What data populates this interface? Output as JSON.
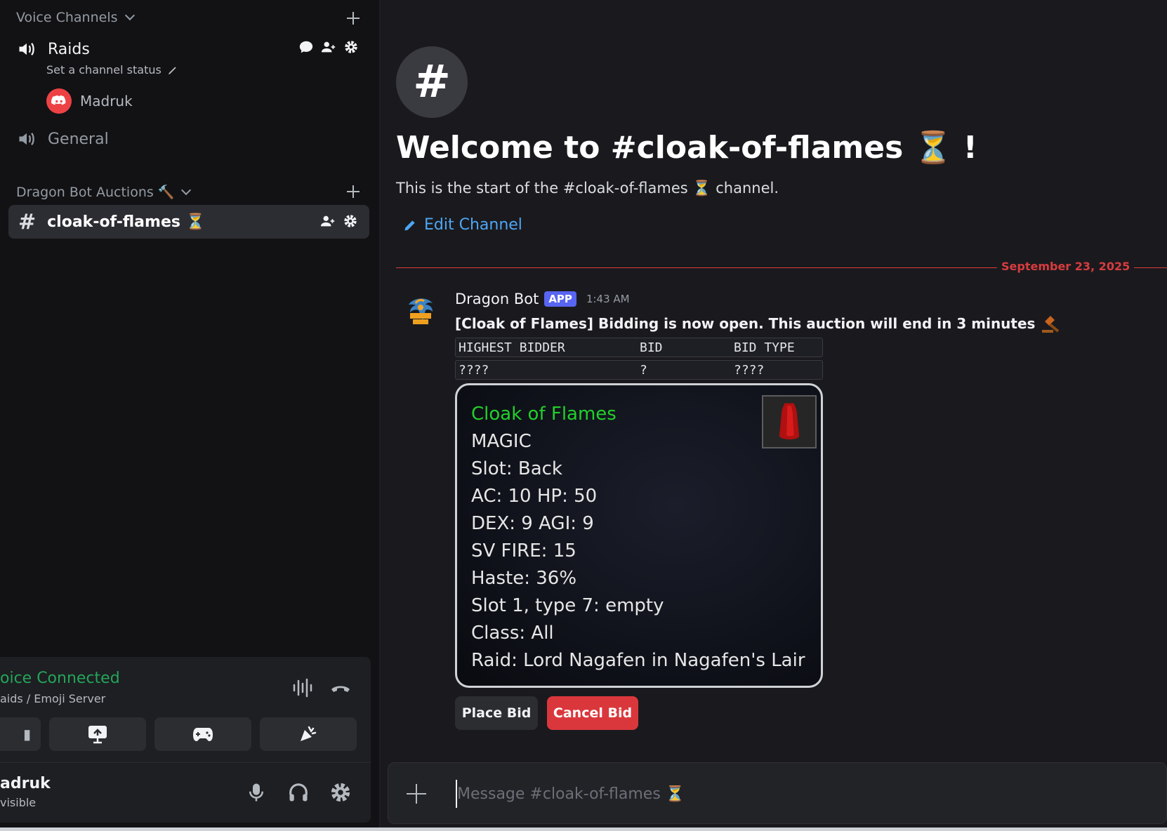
{
  "sidebar": {
    "voice_category": "Voice Channels",
    "voice_channels": [
      {
        "name": "Raids",
        "status": "Set a channel status",
        "members": [
          "Madruk"
        ]
      },
      {
        "name": "General"
      }
    ],
    "auction_category": "Dragon Bot Auctions 🔨",
    "active_channel": "cloak-of-flames ⏳"
  },
  "voice_panel": {
    "status": "oice Connected",
    "server": "aids / Emoji Server"
  },
  "user": {
    "name": "adruk",
    "status": "visible"
  },
  "main": {
    "welcome_title": "Welcome to #cloak-of-flames ⏳ !",
    "start_text": "This is the start of the #cloak-of-flames ⏳  channel.",
    "edit_channel": "Edit Channel",
    "date_divider": "September 23, 2025"
  },
  "message": {
    "author": "Dragon Bot",
    "badge": "APP",
    "timestamp": "1:43 AM",
    "text": "[Cloak of Flames] Bidding is now open.  This auction will end in 3 minutes",
    "table": {
      "headers": [
        "HIGHEST BIDDER",
        "BID",
        "BID TYPE"
      ],
      "row": [
        "????",
        "?",
        "????"
      ]
    },
    "card": {
      "title": "Cloak of Flames",
      "lines": [
        "MAGIC",
        "Slot: Back",
        "AC: 10 HP: 50",
        "DEX: 9 AGI: 9",
        "SV FIRE: 15",
        "Haste: 36%",
        "Slot 1, type 7: empty",
        "Class: All",
        "Raid: Lord Nagafen in Nagafen's Lair"
      ]
    },
    "buttons": {
      "place": "Place Bid",
      "cancel": "Cancel Bid"
    }
  },
  "composer": {
    "placeholder": "Message #cloak-of-flames ⏳"
  },
  "colors": {
    "accent": "#5865f2",
    "danger": "#da373c",
    "connected": "#23a55a",
    "link": "#4ea6f5",
    "item_name": "#22d02a"
  }
}
